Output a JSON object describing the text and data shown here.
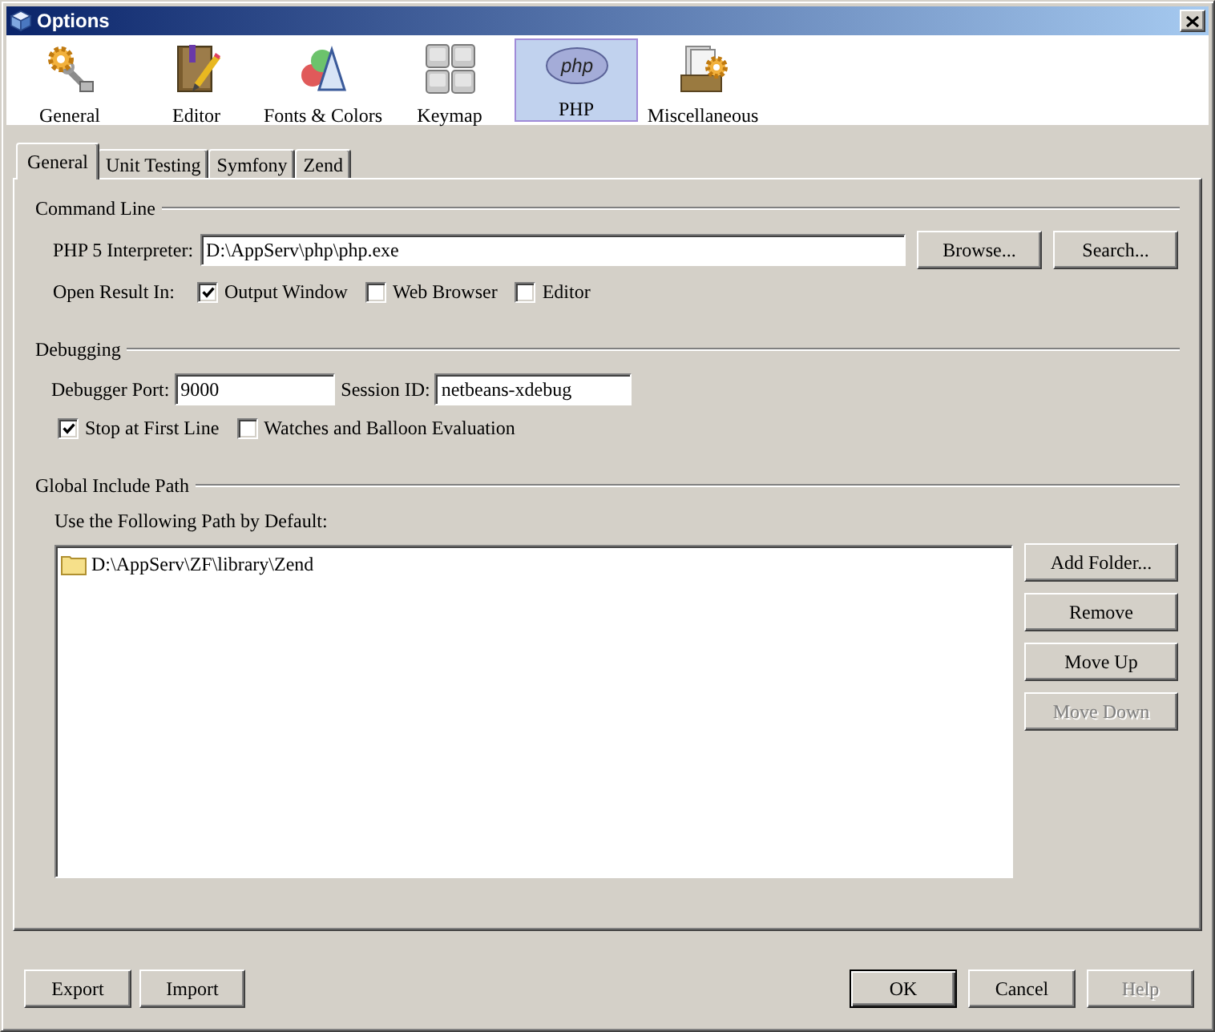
{
  "window": {
    "title": "Options"
  },
  "categories": [
    {
      "label": "General",
      "kind": "general",
      "selected": false
    },
    {
      "label": "Editor",
      "kind": "editor",
      "selected": false
    },
    {
      "label": "Fonts & Colors",
      "kind": "fonts",
      "selected": false
    },
    {
      "label": "Keymap",
      "kind": "keymap",
      "selected": false
    },
    {
      "label": "PHP",
      "kind": "php",
      "icon_text": "php",
      "selected": true
    },
    {
      "label": "Miscellaneous",
      "kind": "misc",
      "selected": false
    }
  ],
  "tabs": [
    {
      "label": "General",
      "selected": true
    },
    {
      "label": "Unit Testing",
      "selected": false
    },
    {
      "label": "Symfony",
      "selected": false
    },
    {
      "label": "Zend",
      "selected": false
    }
  ],
  "command_line": {
    "title": "Command Line",
    "interpreter": {
      "label": "PHP 5 Interpreter:",
      "value": "D:\\AppServ\\php\\php.exe"
    },
    "buttons": [
      {
        "label": "Browse...",
        "disabled": false
      },
      {
        "label": "Search...",
        "disabled": false
      }
    ],
    "open_result": {
      "label": "Open Result In:",
      "options": [
        {
          "label": "Output Window",
          "checked": true
        },
        {
          "label": "Web Browser",
          "checked": false
        },
        {
          "label": "Editor",
          "checked": false
        }
      ]
    }
  },
  "debugging": {
    "title": "Debugging",
    "port": {
      "label": "Debugger Port:",
      "value": "9000"
    },
    "session": {
      "label": "Session ID:",
      "value": "netbeans-xdebug"
    },
    "options": [
      {
        "label": "Stop at First Line",
        "checked": true
      },
      {
        "label": "Watches and Balloon Evaluation",
        "checked": false
      }
    ]
  },
  "include_path": {
    "title": "Global Include Path",
    "caption": "Use the Following Path by Default:",
    "paths": [
      {
        "label": "D:\\AppServ\\ZF\\library\\Zend",
        "selected": false
      }
    ],
    "buttons": [
      {
        "label": "Add Folder...",
        "disabled": false
      },
      {
        "label": "Remove",
        "disabled": false
      },
      {
        "label": "Move Up",
        "disabled": false
      },
      {
        "label": "Move Down",
        "disabled": true
      }
    ]
  },
  "footer": {
    "left": [
      {
        "label": "Export",
        "default": false,
        "disabled": false
      },
      {
        "label": "Import",
        "default": false,
        "disabled": false
      }
    ],
    "right": [
      {
        "label": "OK",
        "default": true,
        "disabled": false
      },
      {
        "label": "Cancel",
        "default": false,
        "disabled": false
      },
      {
        "label": "Help",
        "default": false,
        "disabled": true
      }
    ]
  }
}
